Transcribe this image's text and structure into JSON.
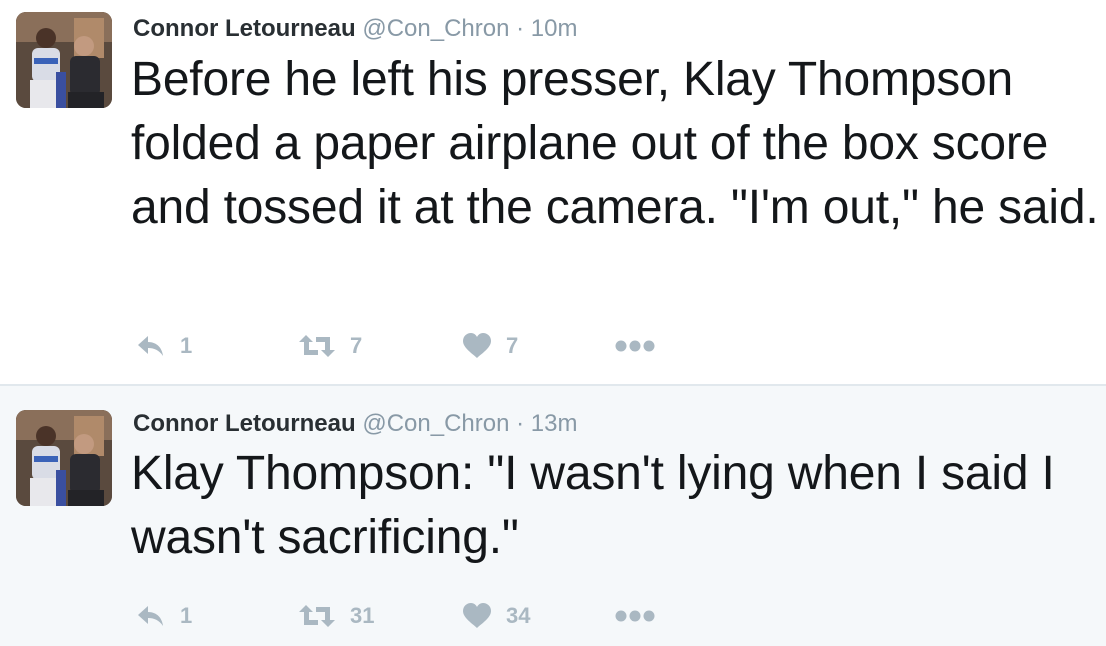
{
  "tweets": [
    {
      "author_name": "Connor Letourneau",
      "handle": "@Con_Chron",
      "separator": "·",
      "time": "10m",
      "text": "Before he left his presser, Klay Thompson folded a paper airplane out of the box score and tossed it at the camera. \"I'm out,\" he said.",
      "reply_count": "1",
      "retweet_count": "7",
      "like_count": "7"
    },
    {
      "author_name": "Connor Letourneau",
      "handle": "@Con_Chron",
      "separator": "·",
      "time": "13m",
      "text": "Klay Thompson: \"I wasn't lying when I said I wasn't sacrificing.\"",
      "reply_count": "1",
      "retweet_count": "31",
      "like_count": "34"
    }
  ],
  "icons": {
    "reply": "reply-icon",
    "retweet": "retweet-icon",
    "like": "heart-icon",
    "more": "more-options-icon"
  },
  "colors": {
    "action_gray": "#aab8c2",
    "meta_gray": "#8899a6",
    "text": "#14171a",
    "alt_background": "#f5f8fa"
  }
}
